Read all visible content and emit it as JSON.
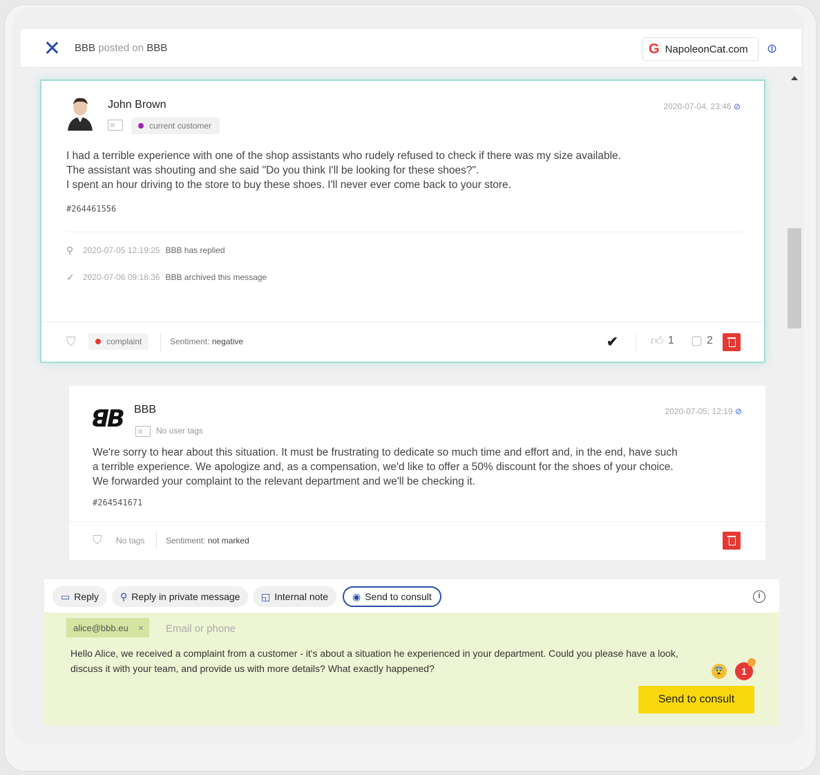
{
  "header": {
    "close_icon": "close-icon",
    "author": "BBB",
    "posted_text": "posted on",
    "page": "BBB",
    "source_label": "NapoleonCat.com",
    "source_icon": "G",
    "link_icon": "link-icon"
  },
  "post": {
    "author": "John Brown",
    "user_tag": "current customer",
    "user_tag_color": "#9c27b0",
    "timestamp": "2020-07-04, 23:46",
    "lines": [
      "I had a terrible experience with one of the shop assistants who rudely refused to check if there was my size available.",
      "The assistant was shouting and she said \"Do you think I'll be looking for these shoes?\".",
      "I spent an hour driving to the store to buy these shoes. I'll never ever come back to your store."
    ],
    "id": "#264461556",
    "events": [
      {
        "time": "2020-07-05 12:19:25",
        "text": "BBB has replied"
      },
      {
        "time": "2020-07-06 09:18:36",
        "text": "BBB archived this message"
      }
    ],
    "tag": "complaint",
    "tag_color": "#e53935",
    "sentiment_label": "Sentiment:",
    "sentiment_value": "negative",
    "likes": "1",
    "comments": "2"
  },
  "reply": {
    "author": "BBB",
    "logo_text": "ꓭB",
    "no_user_tags": "No user tags",
    "timestamp": "2020-07-05, 12:19",
    "lines": [
      "We're sorry to hear about this situation. It must be frustrating to dedicate so much time and effort and, in the end, have such",
      "a terrible experience. We apologize and, as a compensation, we'd like to offer a 50% discount for the shoes of your choice.",
      "We forwarded your complaint to the relevant department and we'll be checking it."
    ],
    "id": "#264541671",
    "tags": "No tags",
    "sentiment_label": "Sentiment:",
    "sentiment_value": "not marked"
  },
  "composer": {
    "tabs": [
      {
        "label": "Reply",
        "icon": "chat-icon"
      },
      {
        "label": "Reply in private message",
        "icon": "private-message-icon"
      },
      {
        "label": "Internal note",
        "icon": "note-icon"
      },
      {
        "label": "Send to consult",
        "icon": "consult-icon"
      }
    ],
    "recipient": "alice@bbb.eu",
    "email_placeholder": "Email or phone",
    "text_line1": "Hello Alice, we received a complaint from a customer - it's about a situation he experienced in your department. Could you please have a look,",
    "text_line2": "discuss it with your team, and provide us with more details? What exactly happened?",
    "badge_count": "1",
    "send_label": "Send to consult"
  }
}
